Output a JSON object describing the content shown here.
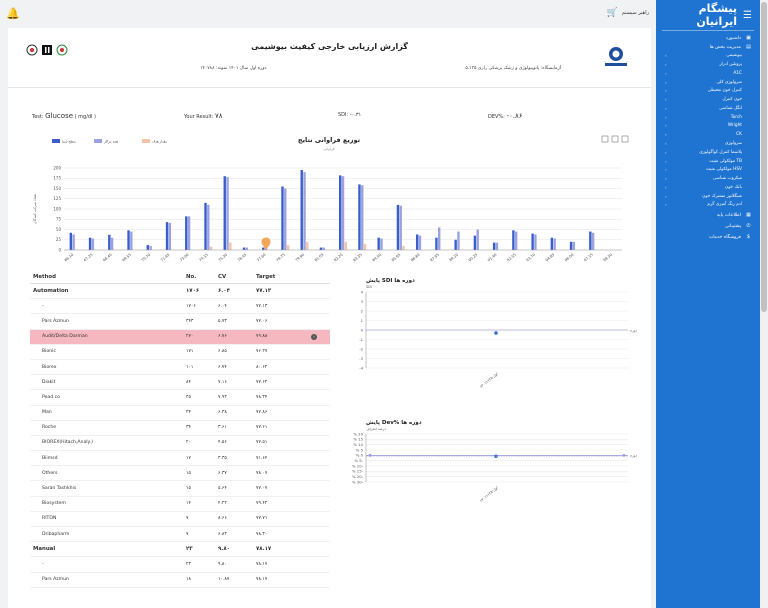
{
  "topbar": {
    "user_label": "راهبر سیستم"
  },
  "sidebar": {
    "brand": "پیشگام ایرانیان",
    "items_top": [
      {
        "label": "داشبورد",
        "icon": "dashboard-icon"
      },
      {
        "label": "مدیریت بخش ها",
        "icon": "folder-icon"
      }
    ],
    "sub_items": [
      "بیوشیمی",
      "پروتئین ادرار",
      "A1C",
      "سرولوژی کلی",
      "کنترل خون محیطی",
      "خون کنترل",
      "انگل شناسی",
      "Torch",
      "Wright",
      "CK",
      "سرولوژی",
      "پلاسما کنترل کواگولوژی",
      "مولکولی مثبت TB",
      "مولکولی مثبت HSV",
      "میکروب شناسی",
      "بانک خون",
      "شیگلاتور مشترک خون",
      "ادم رنگ آمیزی گرم"
    ],
    "items_bottom": [
      {
        "label": "اطلاعات پایه",
        "icon": "database-icon"
      },
      {
        "label": "پشتیبانی",
        "icon": "phone-icon"
      },
      {
        "label": "فروشگاه خدمات",
        "icon": "dollar-icon"
      }
    ]
  },
  "header": {
    "title": "گزارش ارزیابی خارجی کیفیت بیوشیمی",
    "lab": "آزمایشگاه: پاتوبیولوژی و ژنتیک پزشکی رازی ۵.۱۳۵",
    "period": "دوره اول سال ۱۴۰۱ نمونه: ۱۴۰۷۸۸"
  },
  "stats": {
    "test_label": "Test:",
    "test_value": "Glucose",
    "test_unit": "( mg/dl )",
    "your_result_label": "Your Result:",
    "your_result_value": "۷۸",
    "sdi_label": "SDI:",
    "sdi_value": "-۰.۳۱",
    "dev_label": "DEV%:",
    "dev_value": "-۰.۸۶"
  },
  "table": {
    "headers": {
      "method": "Method",
      "no": "No.",
      "cv": "CV",
      "target": "Target"
    },
    "rows": [
      {
        "method": "Automation",
        "no": "۱۷۰۶",
        "cv": "۶.۰۴",
        "target": "۷۷.۱۳",
        "kind": "group"
      },
      {
        "method": "-",
        "no": "۱۷۰۶",
        "cv": "۶.۰۴",
        "target": "۷۷.۱۳",
        "kind": "sub"
      },
      {
        "method": "Pars Azmun",
        "no": "۳۴۳",
        "cv": "۵.۷۳",
        "target": "۷۷.۰۶",
        "kind": "item"
      },
      {
        "method": "Audit/Delta Darman",
        "no": "۲۷۰",
        "cv": "۶.۷۶",
        "target": "۷۹.۸۸",
        "kind": "hl"
      },
      {
        "method": "Bionic",
        "no": "۱۷۱",
        "cv": "۶.۸۵",
        "target": "۷۶.۲۷",
        "kind": "item"
      },
      {
        "method": "Biorex",
        "no": "۱۰۱",
        "cv": "۶.۷۴",
        "target": "۸۰.۶۲",
        "kind": "item"
      },
      {
        "method": "Diakit",
        "no": "۸۴",
        "cv": "۷.۱۶",
        "target": "۷۷.۶۲",
        "kind": "item"
      },
      {
        "method": "Pead co",
        "no": "۳۵",
        "cv": "۷.۹۳",
        "target": "۷۸.۳۴",
        "kind": "item"
      },
      {
        "method": "Man",
        "no": "۳۴",
        "cv": "۶.۳۸",
        "target": "۷۷.۸۶",
        "kind": "item"
      },
      {
        "method": "Roche",
        "no": "۳۴",
        "cv": "۳.۶۱",
        "target": "۷۷.۶۱",
        "kind": "item"
      },
      {
        "method": "BIOREX(Hitach,Analy.)",
        "no": "۲۰",
        "cv": "۴.۵۶",
        "target": "۷۷.۵۱",
        "kind": "item"
      },
      {
        "method": "Biimsd",
        "no": "۱۷",
        "cv": "۳.۳۵",
        "target": "۷۱.۶۴",
        "kind": "item"
      },
      {
        "method": "Others",
        "no": "۱۵",
        "cv": "۶.۳۷",
        "target": "۷۸.۰۷",
        "kind": "item"
      },
      {
        "method": "Saran Tashkhis",
        "no": "۱۵",
        "cv": "۵.۶۴",
        "target": "۷۷.۰۷",
        "kind": "item"
      },
      {
        "method": "Biosystem",
        "no": "۱۴",
        "cv": "۴.۲۲",
        "target": "۷۹.۴۲",
        "kind": "item"
      },
      {
        "method": "RITON",
        "no": "۷",
        "cv": "۸.۶۶",
        "target": "۷۷.۷۱",
        "kind": "item"
      },
      {
        "method": "Dribapharm",
        "no": "۷",
        "cv": "۶.۸۳",
        "target": "۷۸.۳۰",
        "kind": "item"
      },
      {
        "method": "Manual",
        "no": "۲۳",
        "cv": "۹.۸۰",
        "target": "۷۸.۱۷",
        "kind": "group"
      },
      {
        "method": "-",
        "no": "۲۳",
        "cv": "۹.۸۰",
        "target": "۷۸.۱۷",
        "kind": "sub"
      },
      {
        "method": "Pars Azmun",
        "no": "۱۸",
        "cv": "۱۰.۸۷",
        "target": "۷۸.۱۷",
        "kind": "item"
      }
    ]
  },
  "chart_data": [
    {
      "type": "bar",
      "title": "توزیع فراوانی نتایج",
      "subtitle": "فراوانی",
      "ylabel": "تعداد شرکت کنندگان",
      "ylim": [
        0,
        200
      ],
      "yticks": [
        0,
        25,
        50,
        75,
        100,
        125,
        150,
        175,
        200
      ],
      "categories": [
        "66.10",
        "67.25",
        "68.40",
        "69.55",
        "70.70",
        "71.85",
        "73.00",
        "74.15",
        "75.30",
        "76.45",
        "77.60",
        "78.75",
        "79.90",
        "81.05",
        "82.20",
        "83.35",
        "84.50",
        "85.65",
        "86.80",
        "87.95",
        "89.10",
        "90.25",
        "91.40",
        "92.55",
        "93.70",
        "94.85",
        "96.00",
        "97.15",
        "98.30"
      ],
      "categories_raw": [
        "66.10",
        "67.25",
        "68.40",
        "69.55",
        "70.70",
        "71.85",
        "73.00",
        "74.15",
        "75.30",
        "76.45",
        "77.60",
        "78.75",
        "79.90",
        "81.05",
        "82.20",
        "83.35",
        "84.50",
        "85.65",
        "86.80",
        "87.95",
        "89.10",
        "90.25",
        "91.40",
        "92.55",
        "93.70",
        "94.85",
        "96.00",
        "97.15",
        "98.30"
      ],
      "series": [
        {
          "name": "سطح شما",
          "values": [
            42,
            30,
            37,
            48,
            12,
            68,
            82,
            115,
            180,
            6,
            6,
            155,
            195,
            6,
            182,
            160,
            30,
            110,
            38,
            30,
            25,
            35,
            18,
            48,
            40,
            30,
            20,
            45,
            0
          ],
          "color": "#3a5fcd"
        },
        {
          "name": "همه مراکز",
          "values": [
            38,
            28,
            30,
            45,
            10,
            66,
            82,
            110,
            178,
            6,
            6,
            150,
            190,
            6,
            180,
            158,
            28,
            108,
            35,
            55,
            45,
            50,
            18,
            45,
            38,
            28,
            20,
            42,
            0
          ],
          "color": "#9aa2e0"
        },
        {
          "name": "مقدار هدف",
          "values": [
            0,
            0,
            0,
            0,
            0,
            0,
            0,
            8,
            18,
            0,
            0,
            12,
            20,
            0,
            20,
            15,
            0,
            10,
            0,
            0,
            0,
            0,
            0,
            0,
            0,
            0,
            0,
            0,
            0
          ],
          "color": "#f4c3a8"
        }
      ]
    },
    {
      "type": "line",
      "title": "پایش SDI دوره ها",
      "ylabel": "SDI",
      "ylim": [
        -4,
        4
      ],
      "yticks": [
        4,
        3,
        2,
        1,
        0,
        -1,
        -2,
        -3,
        -4
      ],
      "x": [
        "اول-۱۴۰۱۱۱۲۸"
      ],
      "values": [
        -0.31
      ],
      "xlabel": "دوره"
    },
    {
      "type": "line",
      "title": "پایش Dev% دوره ها",
      "ylabel": "درصد انحراف",
      "ylim": [
        -30,
        20
      ],
      "yticks": [
        "% 20",
        "% 15",
        "% 10",
        "% 5",
        "% 0",
        "% 5-",
        "% 10-",
        "% 15-",
        "% 20-",
        "% 30-"
      ],
      "x": [
        "اول-۱۴۰۱۱۱۲۸"
      ],
      "values": [
        -0.86
      ],
      "xlabel": "دوره"
    }
  ]
}
